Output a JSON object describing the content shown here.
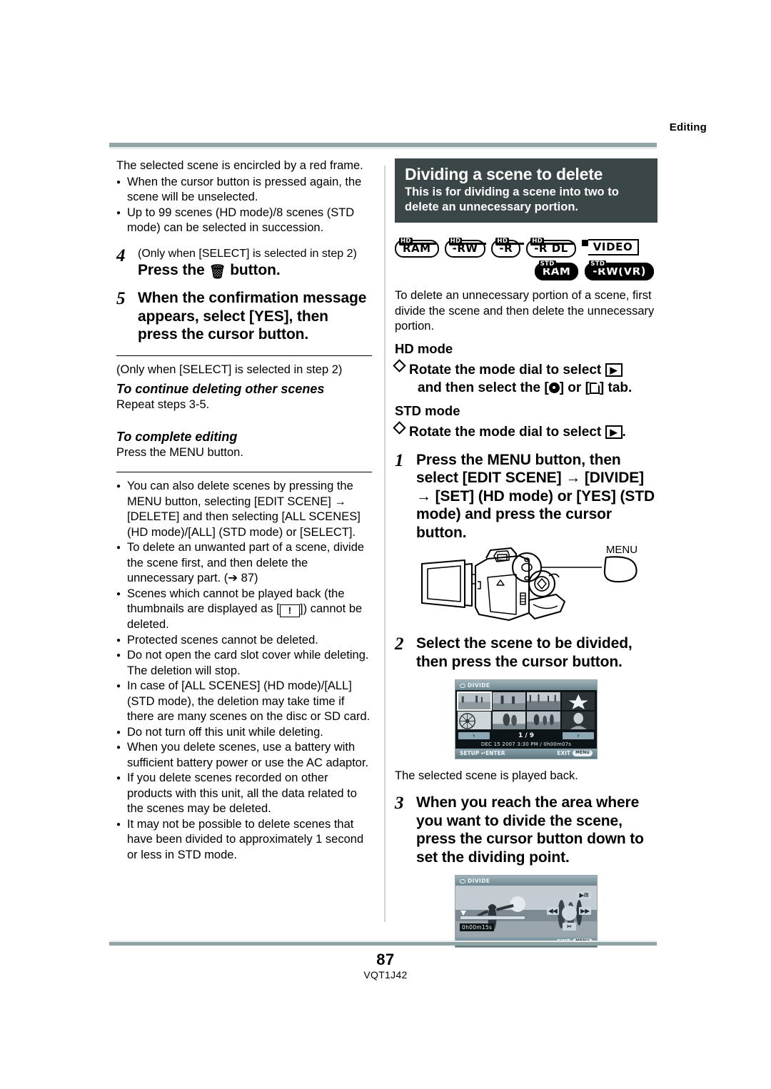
{
  "header": {
    "running_head": "Editing"
  },
  "left": {
    "intro": "The selected scene is encircled by a red frame.",
    "intro_bullets": [
      "When the cursor button is pressed again, the scene will be unselected.",
      "Up to 99 scenes (HD mode)/8 scenes (STD mode) can be selected in succession."
    ],
    "step4": {
      "num": "4",
      "note": "(Only when [SELECT] is selected in step 2)",
      "text_before": "Press the",
      "text_after": "button.",
      "icon": "trash-icon"
    },
    "step5": {
      "num": "5",
      "text": "When the confirmation message appears, select [YES], then press the cursor button."
    },
    "after_note": "(Only when [SELECT] is selected in step 2)",
    "sub1": {
      "heading": "To continue deleting other scenes",
      "body": "Repeat steps 3-5."
    },
    "sub2": {
      "heading": "To complete editing",
      "body": "Press the MENU button."
    },
    "notes": [
      "You can also delete scenes by pressing the MENU button, selecting [EDIT SCENE] → [DELETE] and then selecting [ALL SCENES] (HD mode)/[ALL] (STD mode) or [SELECT].",
      "To delete an unwanted part of a scene, divide the scene first, and then delete the unnecessary part. (➔ 87)",
      "Protected scenes cannot be deleted.",
      "Do not open the card slot cover while deleting. The deletion will stop.",
      "In case of [ALL SCENES] (HD mode)/[ALL] (STD mode), the deletion may take time if there are many scenes on the disc or SD card.",
      "Do not turn off this unit while deleting.",
      "When you delete scenes, use a battery with sufficient battery power or use the AC adaptor.",
      "If you delete scenes recorded on other products with this unit, all the data related to the scenes may be deleted.",
      "It may not be possible to delete scenes that have been divided to approximately 1 second or less in STD mode."
    ],
    "note_scenes": {
      "before": "Scenes which cannot be played back (the thumbnails are displayed as [",
      "glyph": "!",
      "after": "]) cannot be deleted."
    }
  },
  "right": {
    "title": "Dividing a scene to delete",
    "subtitle": "This is for dividing a scene into two to delete an unnecessary portion.",
    "badges_row1": [
      {
        "tag": "HD",
        "label": "RAM",
        "style": "outline"
      },
      {
        "tag": "HD",
        "label": "-RW",
        "style": "outline"
      },
      {
        "tag": "HD",
        "label": "-R",
        "style": "outline"
      },
      {
        "tag": "HD",
        "label": "-R DL",
        "style": "outline"
      },
      {
        "tag": "",
        "label": "VIDEO",
        "style": "video"
      }
    ],
    "badges_row2": [
      {
        "tag": "STD",
        "label": "RAM",
        "style": "filled"
      },
      {
        "tag": "STD",
        "label": "-RW(VR)",
        "style": "filled"
      }
    ],
    "intro": "To delete an unnecessary portion of a scene, first divide the scene and then delete the unnecessary portion.",
    "hd_mode_label": "HD mode",
    "hd_mode_line_a": "Rotate the mode dial to select",
    "hd_mode_line_b_1": "and then select the [",
    "hd_mode_line_b_2": "] or [",
    "hd_mode_line_b_3": "] tab.",
    "std_mode_label": "STD mode",
    "std_mode_line": "Rotate the mode dial to select",
    "std_mode_line_end": ".",
    "step1": {
      "num": "1",
      "text": "Press the MENU button, then select [EDIT SCENE] → [DIVIDE] → [SET] (HD mode) or [YES] (STD mode) and press the cursor button."
    },
    "camcorder": {
      "callout_label": "MENU"
    },
    "step2": {
      "num": "2",
      "text": "Select the scene to be divided, then press the cursor button."
    },
    "lcd_thumbs": {
      "title": "DIVIDE",
      "prev": "‹",
      "next": "›",
      "page": "1 / 9",
      "date": "DEC 15 2007  3:30 PM / 0h00m07s",
      "footer_left": "SETUP ↵ENTER",
      "footer_right": "EXIT",
      "footer_chip": "MENU"
    },
    "caption_playback": "The selected scene is played back.",
    "step3": {
      "num": "3",
      "text": "When you reach the area where you want to divide the scene, press the cursor button down to set the dividing point."
    },
    "lcd_playback": {
      "title": "DIVIDE",
      "play_pause": "▶/II",
      "rewind": "◀◀",
      "forward": "▶▶",
      "scissors": "✂",
      "timecode": "0h00m15s",
      "footer_right": "EXIT",
      "footer_chip": "MENU"
    }
  },
  "footer": {
    "page_number": "87",
    "doc_code": "VQT1J42"
  },
  "colors": {
    "rule": "#8fa4a3",
    "title_block_bg": "#3b4649",
    "lcd_bg": "#0d1417",
    "lcd_accent": "#8fa8b5"
  }
}
